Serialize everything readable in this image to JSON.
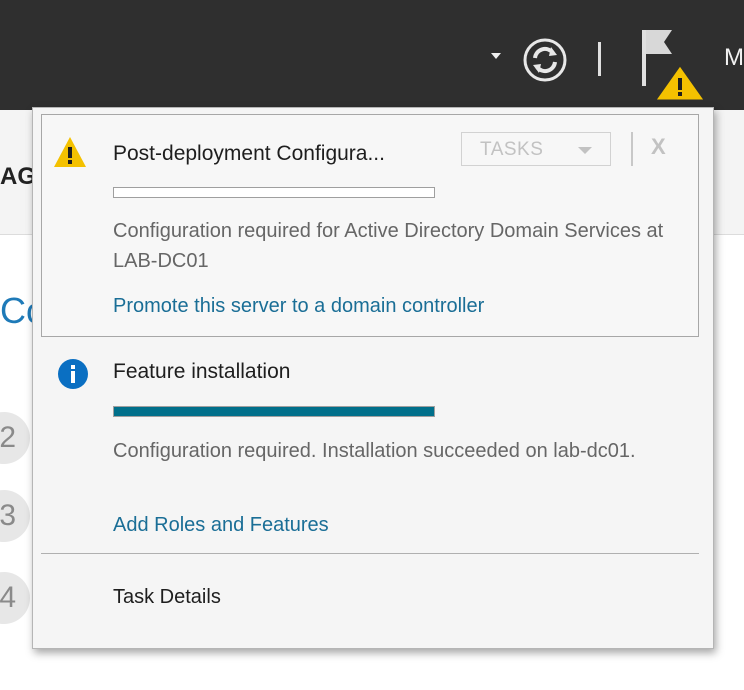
{
  "topbar": {
    "refresh_icon": "refresh-icon",
    "flag_icon": "flag-warning-icon",
    "menu_partial": "M"
  },
  "background": {
    "header_partial": "AGE",
    "title_partial": "Co",
    "steps": [
      "2",
      "3",
      "4"
    ]
  },
  "notifications": [
    {
      "icon": "warning-icon",
      "title": "Post-deployment Configura...",
      "progress": 0,
      "description": "Configuration required for Active Directory Domain Services at LAB-DC01",
      "link": "Promote this server to a domain controller",
      "tasks_label": "TASKS",
      "close_label": "X"
    },
    {
      "icon": "info-icon",
      "title": "Feature installation",
      "progress": 1,
      "description": "Configuration required. Installation succeeded on lab-dc01.",
      "link": "Add Roles and Features"
    }
  ],
  "footer": {
    "task_details": "Task Details"
  },
  "colors": {
    "topbar": "#2f2f2f",
    "progress_fill": "#006f8a",
    "link": "#1a6e96",
    "warning": "#f4c100",
    "info": "#0a6fc2"
  }
}
